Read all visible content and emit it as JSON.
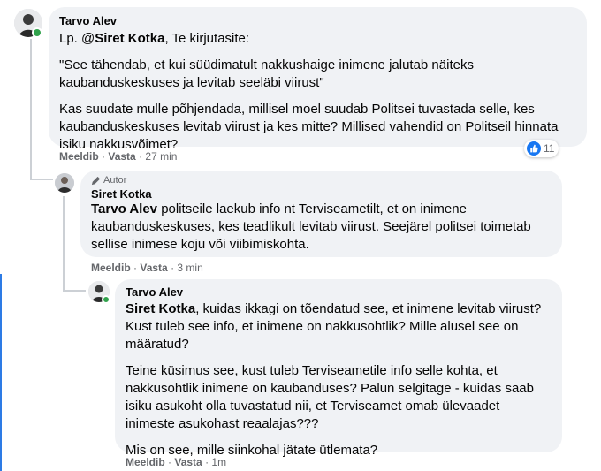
{
  "comments": [
    {
      "author": "Tarvo Alev",
      "paragraphs": [
        {
          "prefix": "Lp. @",
          "mention": "Siret Kotka",
          "text": ", Te kirjutasite:"
        },
        {
          "prefix": "",
          "mention": "",
          "text": "\"See tähendab, et kui süüdimatult nakkushaige inimene jalutab näiteks kaubanduskeskuses ja levitab seeläbi viirust\""
        },
        {
          "prefix": "",
          "mention": "",
          "text": "Kas suudate mulle põhjendada, millisel moel suudab Politsei tuvastada selle, kes kaubanduskeskuses levitab viirust ja kes mitte? Millised vahendid on Politseil hinnata isiku nakkusvõimet?"
        }
      ],
      "like_label": "Meeldib",
      "reply_label": "Vasta",
      "time": "27 min",
      "reaction_count": "11"
    },
    {
      "badge": "Autor",
      "author": "Siret Kotka",
      "paragraphs": [
        {
          "prefix": "",
          "mention": "Tarvo Alev",
          "text": " politseile laekub info nt Terviseametilt, et on inimene kaubanduskeskuses, kes teadlikult levitab viirust. Seejärel politsei toimetab sellise inimese koju või viibimiskohta."
        }
      ],
      "like_label": "Meeldib",
      "reply_label": "Vasta",
      "time": "3 min"
    },
    {
      "author": "Tarvo Alev",
      "paragraphs": [
        {
          "prefix": "",
          "mention": "Siret Kotka",
          "text": ", kuidas ikkagi on tõendatud see, et inimene levitab viirust? Kust tuleb see info, et inimene on nakkusohtlik? Mille alusel see on määratud?"
        },
        {
          "prefix": "",
          "mention": "",
          "text": "Teine küsimus see, kust tuleb Terviseametile info selle kohta, et nakkusohtlik inimene on kaubanduses? Palun selgitage - kuidas saab isiku asukoht olla tuvastatud nii, et Terviseamet omab ülevaadet inimeste asukohast reaalajas???"
        },
        {
          "prefix": "",
          "mention": "",
          "text": "Mis on see, mille siinkohal jätate ütlemata?"
        }
      ],
      "like_label": "Meeldib",
      "reply_label": "Vasta",
      "time": "1m"
    }
  ],
  "separator": "·",
  "colors": {
    "like": "#1877f2",
    "online": "#31a24c",
    "bubble": "#f0f2f5",
    "meta": "#65676b"
  },
  "icons": {
    "reaction": "thumbs-up-icon",
    "badge": "pencil-icon"
  }
}
